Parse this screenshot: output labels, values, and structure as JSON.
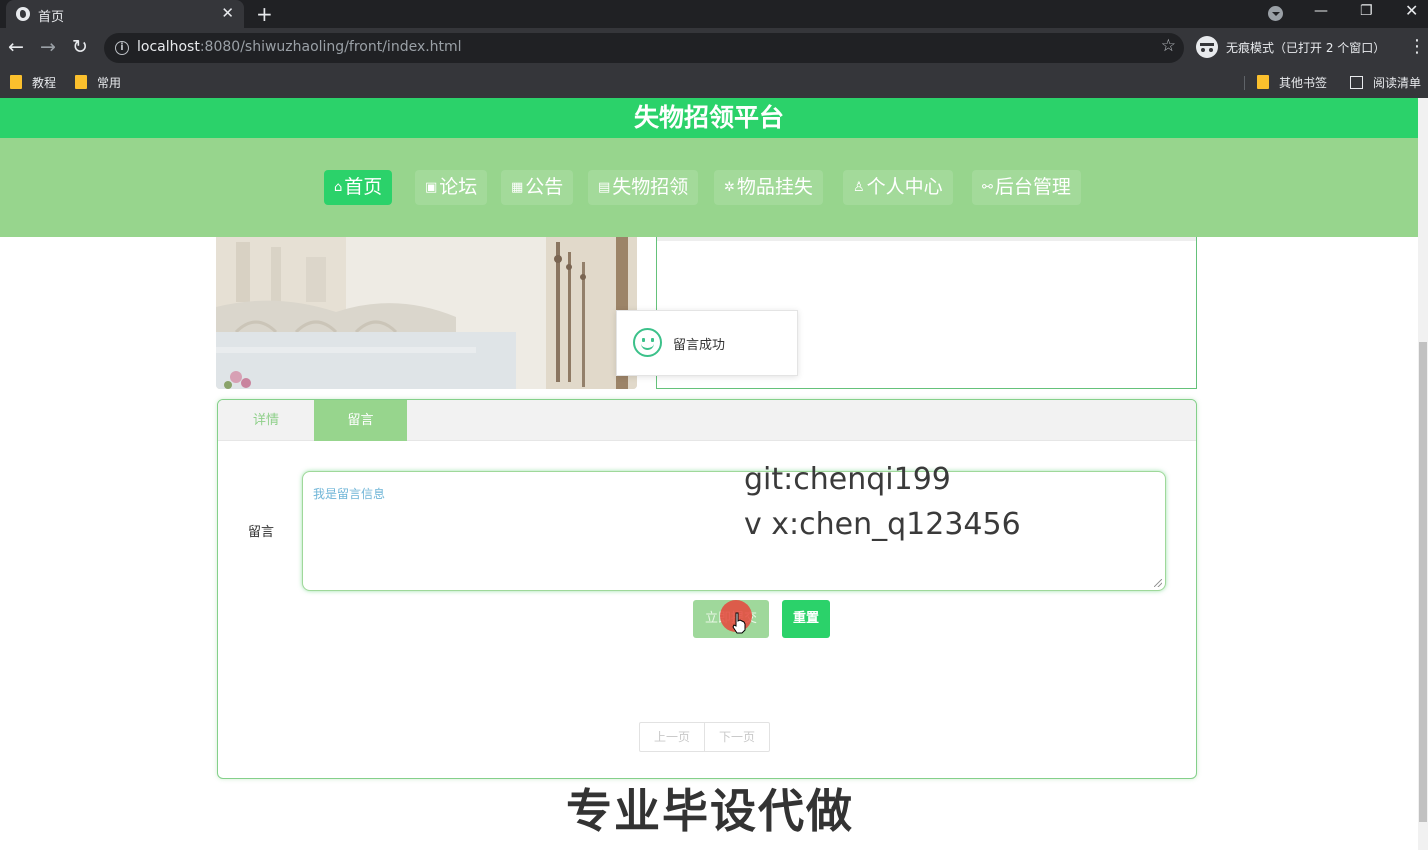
{
  "browser": {
    "tab_title": "首页",
    "tab_close": "✕",
    "new_tab": "+",
    "url_host": "localhost",
    "url_rest": ":8080/shiwuzhaoling/front/index.html",
    "incognito_label": "无痕模式（已打开 2 个窗口）",
    "bookmarks": [
      "教程",
      "常用"
    ],
    "other_bookmarks": "其他书签",
    "reading_list": "阅读清单"
  },
  "site": {
    "title": "失物招领平台",
    "nav": [
      {
        "icon": "⌂",
        "label": "首页",
        "active": true
      },
      {
        "icon": "▣",
        "label": "论坛",
        "active": false
      },
      {
        "icon": "▦",
        "label": "公告",
        "active": false
      },
      {
        "icon": "▤",
        "label": "失物招领",
        "active": false
      },
      {
        "icon": "✲",
        "label": "物品挂失",
        "active": false
      },
      {
        "icon": "♙",
        "label": "个人中心",
        "active": false
      },
      {
        "icon": "⚯",
        "label": "后台管理",
        "active": false
      }
    ]
  },
  "toast": {
    "text": "留言成功"
  },
  "detail_tabs": [
    {
      "label": "详情"
    },
    {
      "label": "留言"
    }
  ],
  "form": {
    "label": "留言",
    "textarea_placeholder": "我是留言信息",
    "submit_label": "立即提交",
    "reset_label": "重置"
  },
  "pager": {
    "prev": "上一页",
    "next": "下一页"
  },
  "overlay": {
    "git": "git:chenqi199",
    "wx": "v x:chen_q123456",
    "banner": "专业毕设代做"
  },
  "colors": {
    "header_green": "#2bd26a",
    "nav_green": "#97d58d"
  }
}
